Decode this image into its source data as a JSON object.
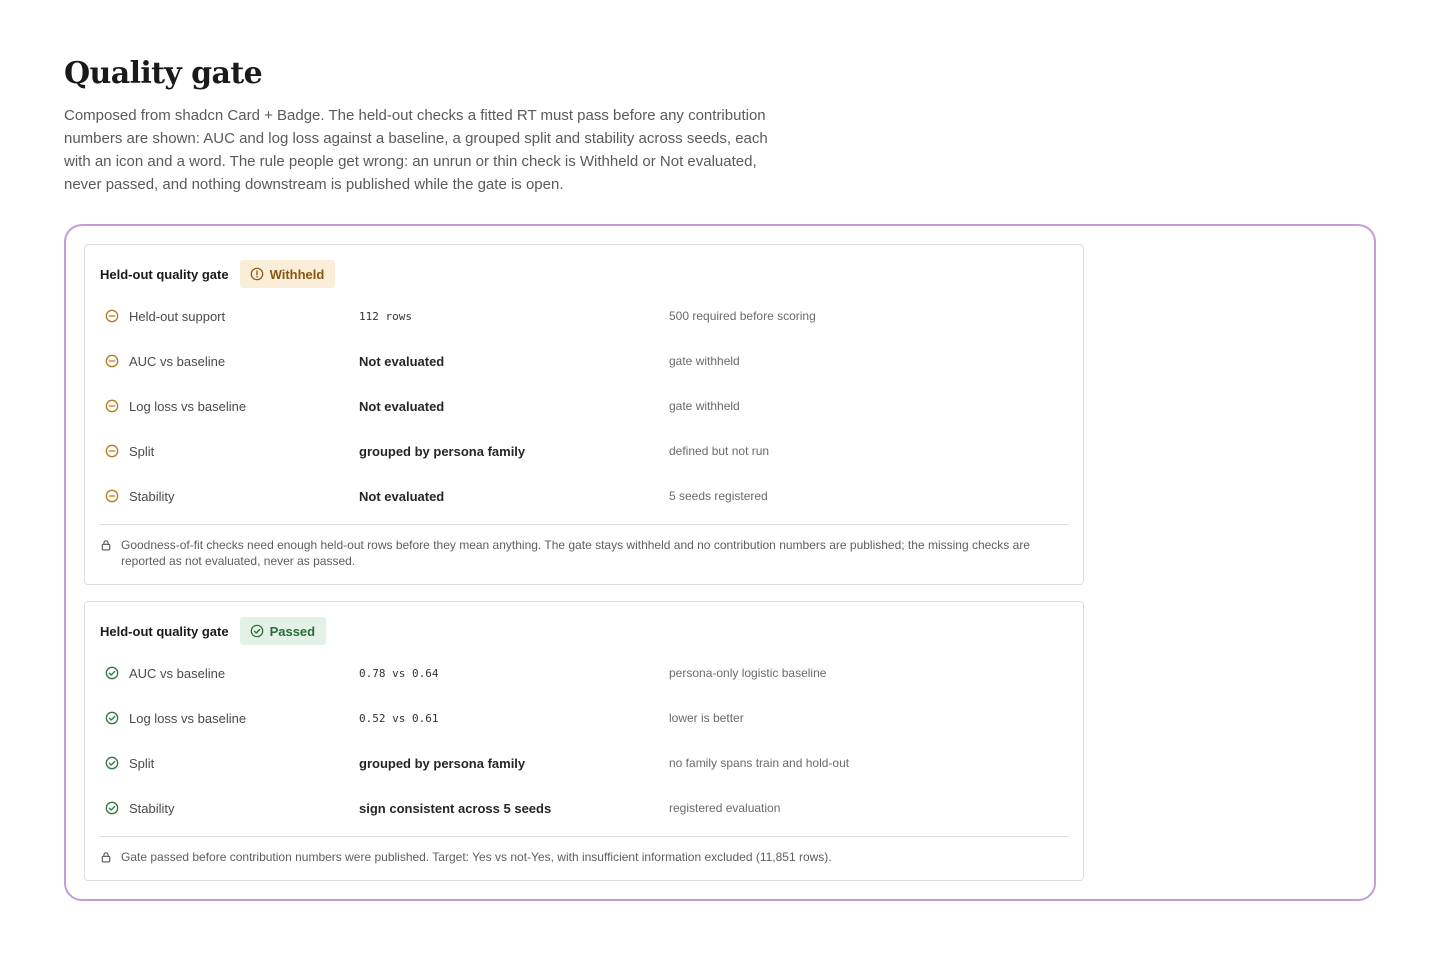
{
  "page": {
    "title": "Quality gate",
    "description": "Composed from shadcn Card + Badge. The held-out checks a fitted RT must pass before any contribution numbers are shown: AUC and log loss against a baseline, a grouped split and stability across seeds, each with an icon and a word. The rule people get wrong: an unrun or thin check is Withheld or Not evaluated, never passed, and nothing downstream is published while the gate is open."
  },
  "colors": {
    "frame_border": "#c39bd6",
    "warn": "#b87a22",
    "warn_bg": "#fbeed8",
    "ok": "#2f7a3f",
    "ok_bg": "#e4f1e6"
  },
  "cards": [
    {
      "title": "Held-out quality gate",
      "status": "Withheld",
      "status_icon": "alert-circle-icon",
      "row_icon": "minus-circle-icon",
      "rows": [
        {
          "label": "Held-out support",
          "value": "112 rows",
          "mono": true,
          "note": "500 required before scoring"
        },
        {
          "label": "AUC vs baseline",
          "value": "Not evaluated",
          "mono": false,
          "note": "gate withheld"
        },
        {
          "label": "Log loss vs baseline",
          "value": "Not evaluated",
          "mono": false,
          "note": "gate withheld"
        },
        {
          "label": "Split",
          "value": "grouped by persona family",
          "mono": false,
          "note": "defined but not run"
        },
        {
          "label": "Stability",
          "value": "Not evaluated",
          "mono": false,
          "note": "5 seeds registered"
        }
      ],
      "footnote_icon": "lock-icon",
      "footnote": "Goodness-of-fit checks need enough held-out rows before they mean anything. The gate stays withheld and no contribution numbers are published; the missing checks are reported as not evaluated, never as passed."
    },
    {
      "title": "Held-out quality gate",
      "status": "Passed",
      "status_icon": "check-circle-icon",
      "row_icon": "check-circle-icon",
      "rows": [
        {
          "label": "AUC vs baseline",
          "value": "0.78 vs 0.64",
          "mono": true,
          "note": "persona-only logistic baseline"
        },
        {
          "label": "Log loss vs baseline",
          "value": "0.52 vs 0.61",
          "mono": true,
          "note": "lower is better"
        },
        {
          "label": "Split",
          "value": "grouped by persona family",
          "mono": false,
          "note": "no family spans train and hold-out"
        },
        {
          "label": "Stability",
          "value": "sign consistent across 5 seeds",
          "mono": false,
          "note": "registered evaluation"
        }
      ],
      "footnote_icon": "lock-icon",
      "footnote": "Gate passed before contribution numbers were published. Target: Yes vs not-Yes, with insufficient information excluded (11,851 rows)."
    }
  ]
}
